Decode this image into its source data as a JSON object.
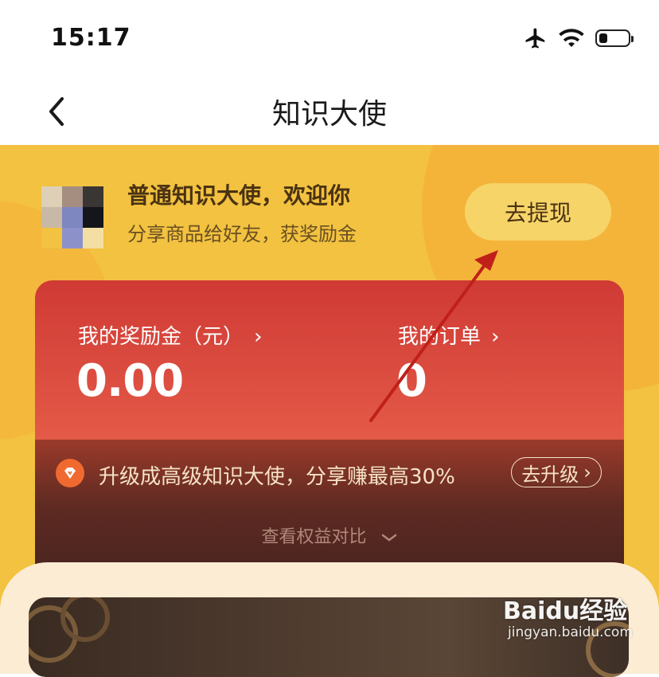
{
  "status_bar": {
    "time": "15:17",
    "icons": [
      "airplane-icon",
      "wifi-icon",
      "battery-icon"
    ]
  },
  "nav": {
    "title": "知识大使",
    "back_icon": "chevron-left-icon"
  },
  "header": {
    "greeting": "普通知识大使，欢迎你",
    "subtitle": "分享商品给好友，获奖励金",
    "withdraw_label": "去提现"
  },
  "stats": {
    "reward": {
      "label": "我的奖励金（元）",
      "value": "0.00",
      "arrow": "›"
    },
    "orders": {
      "label": "我的订单",
      "value": "0",
      "arrow": "›"
    }
  },
  "upgrade": {
    "text": "升级成高级知识大使，分享赚最高30%",
    "button_label": "去升级",
    "button_arrow": "›",
    "compare_label": "查看权益对比",
    "compare_icon": "chevron-down-icon"
  },
  "watermark": {
    "brand": "Baidu经验",
    "url": "jingyan.baidu.com"
  },
  "colors": {
    "brand_yellow": "#f2c240",
    "card_red": "#d9453c",
    "card_dark": "#4a2420",
    "accent_orange": "#f06a30"
  }
}
